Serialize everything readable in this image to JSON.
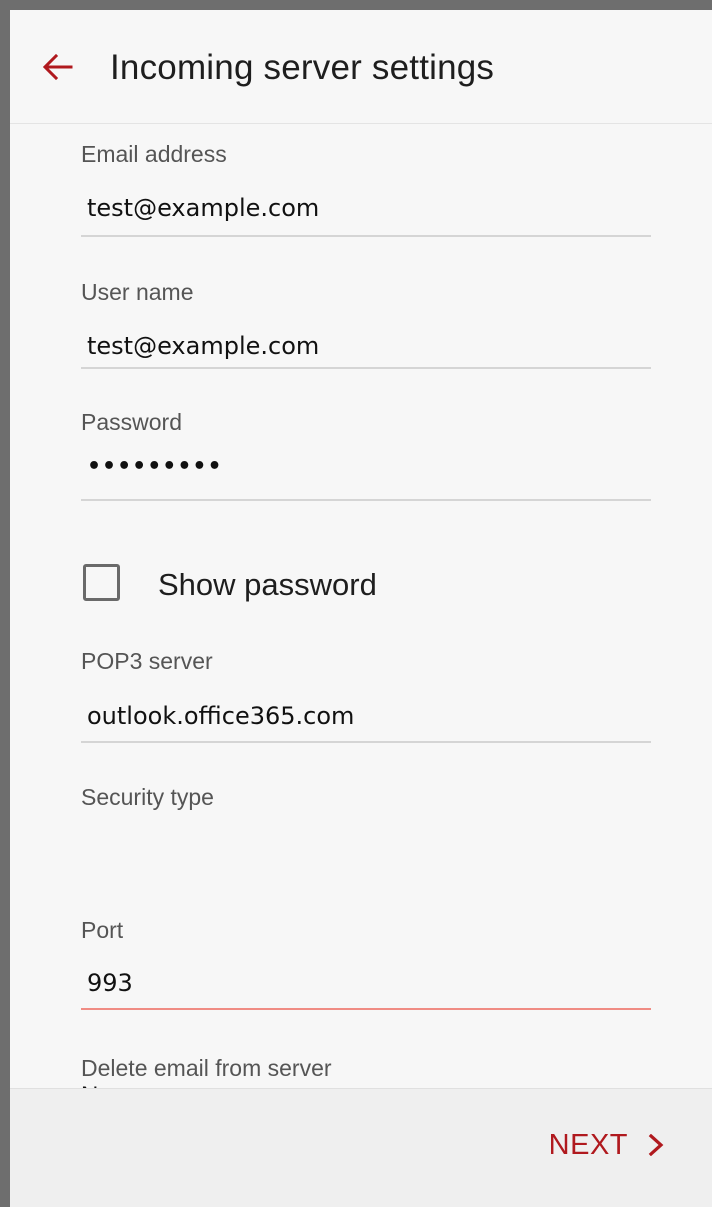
{
  "header": {
    "title": "Incoming server settings",
    "back_icon": "arrow-left-icon"
  },
  "form": {
    "email": {
      "label": "Email address",
      "value": "test@example.com"
    },
    "username": {
      "label": "User name",
      "value": "test@example.com"
    },
    "password": {
      "label": "Password",
      "value": "•••••••••"
    },
    "show_password": {
      "label": "Show password",
      "checked": false
    },
    "pop3_server": {
      "label": "POP3 server",
      "value": "outlook.office365.com"
    },
    "security_type": {
      "label": "Security type",
      "value": ""
    },
    "port": {
      "label": "Port",
      "value": "993"
    },
    "delete_email": {
      "label": "Delete email from server",
      "value_partial": "N"
    }
  },
  "footer": {
    "next_label": "NEXT",
    "next_icon": "chevron-right-icon"
  },
  "colors": {
    "accent": "#b0191e",
    "active_underline": "#f08c84",
    "background": "#f7f7f7"
  }
}
